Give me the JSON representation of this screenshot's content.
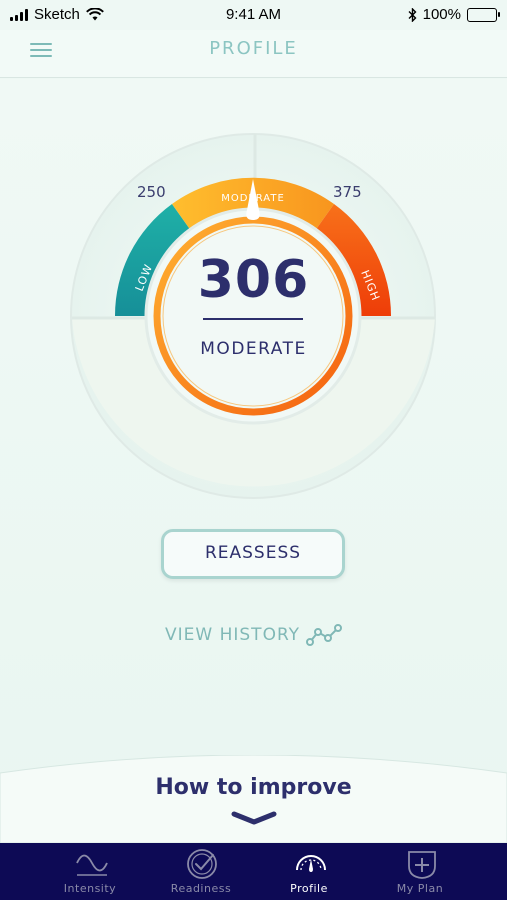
{
  "status_bar": {
    "carrier": "Sketch",
    "time": "9:41 AM",
    "battery": "100%"
  },
  "header": {
    "title": "PROFILE"
  },
  "gauge": {
    "score": "306",
    "level": "MODERATE",
    "low_threshold": "250",
    "high_threshold": "375",
    "segments": [
      {
        "label": "LOW",
        "color": "#1fa7a5"
      },
      {
        "label": "MODERATE",
        "color": "#f7a823"
      },
      {
        "label": "HIGH",
        "color": "#f24f10"
      }
    ]
  },
  "actions": {
    "reassess": "REASSESS",
    "view_history": "VIEW HISTORY"
  },
  "improve": {
    "title": "How to improve"
  },
  "tabs": [
    {
      "label": "Intensity",
      "icon": "wave-icon"
    },
    {
      "label": "Readiness",
      "icon": "check-circle-icon"
    },
    {
      "label": "Profile",
      "icon": "gauge-icon",
      "active": true
    },
    {
      "label": "My Plan",
      "icon": "plus-shield-icon"
    }
  ],
  "colors": {
    "accent": "#8cc5c2",
    "navy": "#2d2f6c",
    "tabbar": "#0d0a55"
  }
}
